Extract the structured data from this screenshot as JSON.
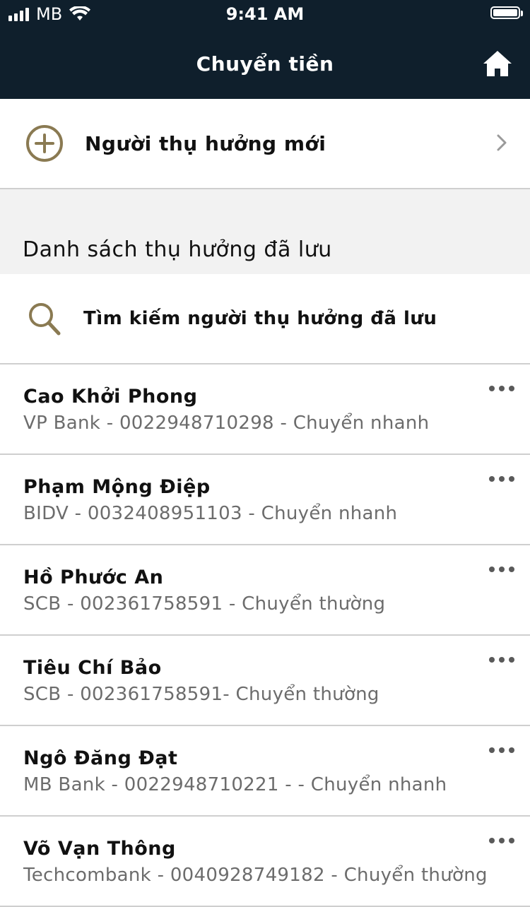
{
  "status_bar": {
    "carrier": "MB",
    "time": "9:41 AM"
  },
  "header": {
    "title": "Chuyển tiền",
    "home_icon": "home-icon"
  },
  "new_beneficiary": {
    "label": "Người thụ hưởng mới",
    "icon": "plus-circle-icon"
  },
  "saved_section": {
    "title": "Danh sách thụ hưởng đã lưu"
  },
  "search": {
    "label": "Tìm kiếm người thụ hưởng đã lưu",
    "icon": "search-icon"
  },
  "beneficiaries": [
    {
      "name": "Cao Khởi Phong",
      "detail": "VP Bank - 0022948710298 - Chuyển nhanh"
    },
    {
      "name": "Phạm Mộng Điệp",
      "detail": "BIDV - 0032408951103 - Chuyển nhanh"
    },
    {
      "name": "Hồ Phước An",
      "detail": "SCB - 002361758591 - Chuyển thường"
    },
    {
      "name": "Tiêu Chí Bảo",
      "detail": "SCB - 002361758591- Chuyển thường"
    },
    {
      "name": "Ngô Đăng Đạt",
      "detail": "MB Bank - 0022948710221 - - Chuyển nhanh"
    },
    {
      "name": "Võ Vạn Thông",
      "detail": "Techcombank - 0040928749182 - Chuyển thường"
    }
  ],
  "colors": {
    "header_bg": "#0f1f2c",
    "accent_gold": "#8a7a52",
    "section_bg": "#f2f2f2"
  }
}
